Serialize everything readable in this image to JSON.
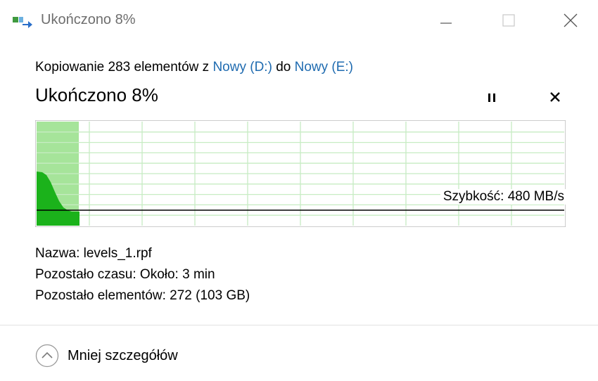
{
  "window": {
    "title": "Ukończono 8%",
    "icon": "copy-file-icon"
  },
  "copy": {
    "prefix": "Kopiowanie 283 elementów z",
    "source": "Nowy (D:)",
    "middle": "do",
    "destination": "Nowy (E:)"
  },
  "status": {
    "heading": "Ukończono 8%",
    "progress_percent": 8
  },
  "graph": {
    "speed_label": "Szybkość: 480 MB/s",
    "colors": {
      "progress_fill": "#a6e49a",
      "speed_fill": "#1bb21b",
      "grid": "#c7ecc3",
      "line": "#000000"
    }
  },
  "details": {
    "name_label": "Nazwa:",
    "name_value": "levels_1.rpf",
    "time_label": "Pozostało czasu:",
    "time_value": "Około: 3 min",
    "items_label": "Pozostało elementów:",
    "items_value": "272 (103 GB)"
  },
  "footer": {
    "less_details": "Mniej szczegółów"
  }
}
